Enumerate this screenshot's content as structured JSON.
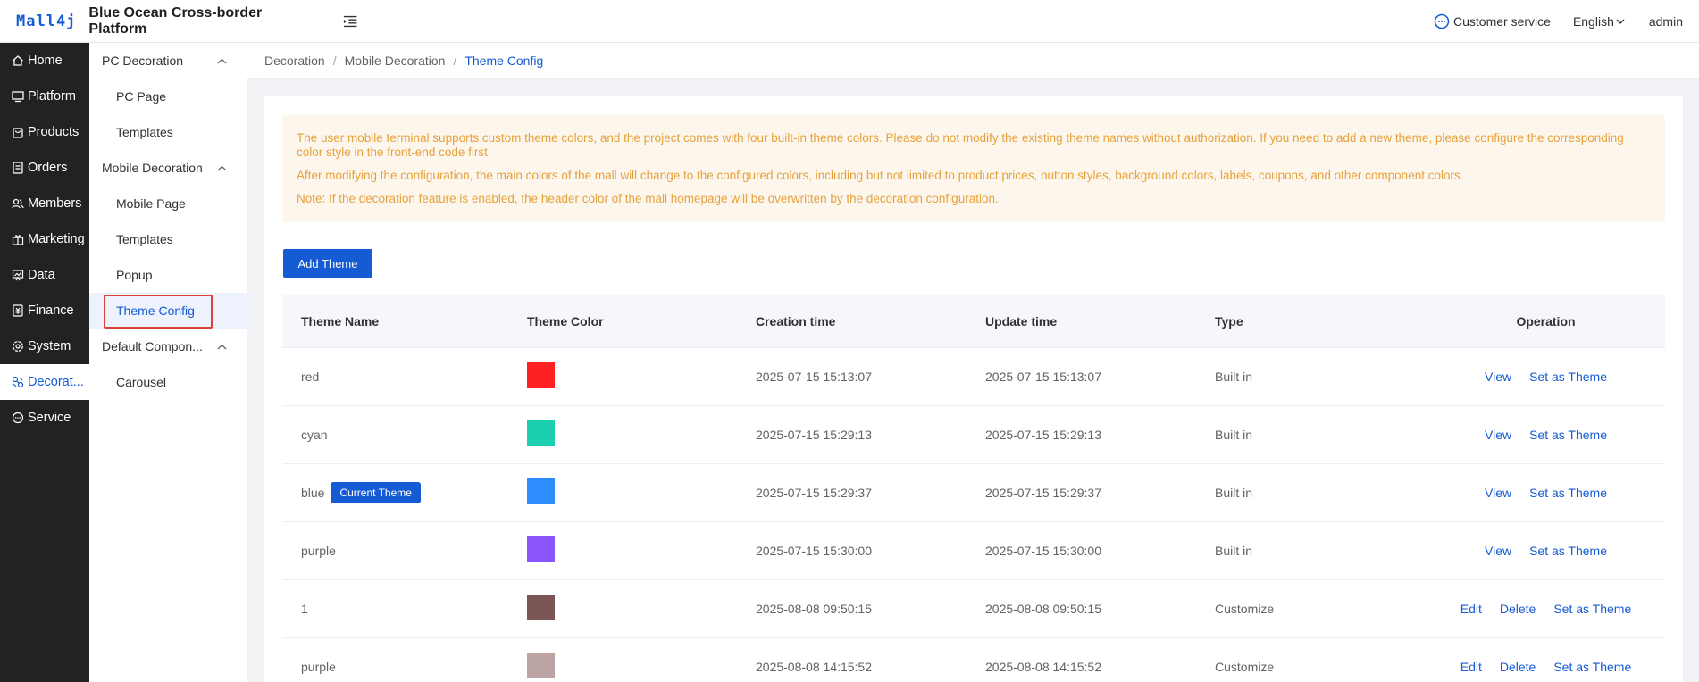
{
  "header": {
    "logo_text": "Mall4j",
    "title": "Blue Ocean Cross-border Platform",
    "customer_service": "Customer service",
    "language": "English",
    "user": "admin"
  },
  "sidebar": {
    "items": [
      {
        "label": "Home",
        "icon": "home-icon"
      },
      {
        "label": "Platform",
        "icon": "monitor-icon"
      },
      {
        "label": "Products",
        "icon": "bag-icon"
      },
      {
        "label": "Orders",
        "icon": "document-icon"
      },
      {
        "label": "Members",
        "icon": "users-icon"
      },
      {
        "label": "Marketing",
        "icon": "gift-icon"
      },
      {
        "label": "Data",
        "icon": "chart-icon"
      },
      {
        "label": "Finance",
        "icon": "finance-icon"
      },
      {
        "label": "System",
        "icon": "gear-icon"
      },
      {
        "label": "Decorat...",
        "icon": "decoration-icon"
      },
      {
        "label": "Service",
        "icon": "chat-icon"
      }
    ]
  },
  "subsidebar": {
    "groups": [
      {
        "label": "PC Decoration",
        "items": [
          "PC Page",
          "Templates"
        ]
      },
      {
        "label": "Mobile Decoration",
        "items": [
          "Mobile Page",
          "Templates",
          "Popup",
          "Theme Config"
        ]
      },
      {
        "label": "Default Compon...",
        "items": [
          "Carousel"
        ]
      }
    ]
  },
  "breadcrumb": [
    "Decoration",
    "Mobile Decoration",
    "Theme Config"
  ],
  "notice": [
    "The user mobile terminal supports custom theme colors, and the project comes with four built-in theme colors. Please do not modify the existing theme names without authorization. If you need to add a new theme, please configure the corresponding color style in the front-end code first",
    "After modifying the configuration, the main colors of the mall will change to the configured colors, including but not limited to product prices, button styles, background colors, labels, coupons, and other component colors.",
    "Note: If the decoration feature is enabled, the header color of the mall homepage will be overwritten by the decoration configuration."
  ],
  "add_button": "Add Theme",
  "table": {
    "headers": [
      "Theme Name",
      "Theme Color",
      "Creation time",
      "Update time",
      "Type",
      "Operation"
    ],
    "current_badge": "Current Theme",
    "op_labels": {
      "view": "View",
      "edit": "Edit",
      "delete": "Delete",
      "set": "Set as Theme"
    },
    "rows": [
      {
        "name": "red",
        "color": "#ff2121",
        "created": "2025-07-15 15:13:07",
        "updated": "2025-07-15 15:13:07",
        "type": "Built in"
      },
      {
        "name": "cyan",
        "color": "#1ccfaf",
        "created": "2025-07-15 15:29:13",
        "updated": "2025-07-15 15:29:13",
        "type": "Built in"
      },
      {
        "name": "blue",
        "color": "#2f8cff",
        "created": "2025-07-15 15:29:37",
        "updated": "2025-07-15 15:29:37",
        "type": "Built in"
      },
      {
        "name": "purple",
        "color": "#8b55fd",
        "created": "2025-07-15 15:30:00",
        "updated": "2025-07-15 15:30:00",
        "type": "Built in"
      },
      {
        "name": "1",
        "color": "#7c5555",
        "created": "2025-08-08 09:50:15",
        "updated": "2025-08-08 09:50:15",
        "type": "Customize"
      },
      {
        "name": "purple",
        "color": "#bda4a4",
        "created": "2025-08-08 14:15:52",
        "updated": "2025-08-08 14:15:52",
        "type": "Customize"
      }
    ]
  },
  "colors": {
    "accent": "#155bd4",
    "sidebar_bg": "#222222",
    "notice_text": "#e6a23c",
    "notice_bg": "#fdf6ec"
  }
}
